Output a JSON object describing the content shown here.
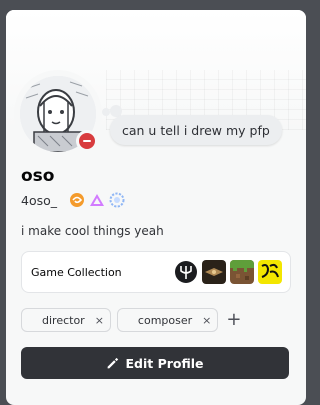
{
  "profile": {
    "display_name": "oso",
    "username": "4oso_",
    "custom_status": "can u tell i drew my pfp",
    "bio": "i make cool things yeah",
    "status": "do-not-disturb",
    "status_color": "#d83c3e",
    "badges": [
      "orange-swirl-badge-icon",
      "pink-triangle-badge-icon",
      "blue-gear-badge-icon"
    ]
  },
  "game_collection": {
    "label": "Game Collection",
    "games": [
      "trident-game-icon",
      "dark-emblem-game-icon",
      "minecraft-block-game-icon",
      "yellow-logo-game-icon"
    ]
  },
  "roles": {
    "items": [
      {
        "label": "director"
      },
      {
        "label": "composer"
      }
    ],
    "remove_glyph": "×",
    "add_glyph": "+"
  },
  "actions": {
    "edit_profile_label": "Edit Profile"
  },
  "colors": {
    "card_background": "#f7f8f8",
    "button_background": "#313338",
    "page_background": "#4b4e54"
  }
}
